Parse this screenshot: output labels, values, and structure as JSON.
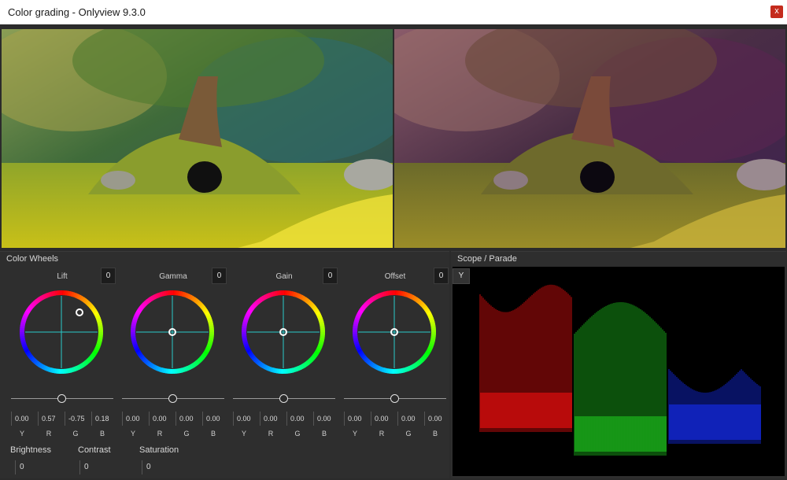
{
  "window": {
    "title": "Color grading - Onlyview  9.3.0",
    "close_label": "x"
  },
  "panels": {
    "wheels_title": "Color Wheels",
    "scope_title": "Scope / Parade"
  },
  "wheels": [
    {
      "name": "Lift",
      "count": "0",
      "values": [
        "0.00",
        "0.57",
        "-0.75",
        "0.18"
      ],
      "slider": 0.5
    },
    {
      "name": "Gamma",
      "count": "0",
      "values": [
        "0.00",
        "0.00",
        "0.00",
        "0.00"
      ],
      "slider": 0.5
    },
    {
      "name": "Gain",
      "count": "0",
      "values": [
        "0.00",
        "0.00",
        "0.00",
        "0.00"
      ],
      "slider": 0.5
    },
    {
      "name": "Offset",
      "count": "0",
      "values": [
        "0.00",
        "0.00",
        "0.00",
        "0.00"
      ],
      "slider": 0.5
    }
  ],
  "channels": [
    "Y",
    "R",
    "G",
    "B"
  ],
  "adjustments": {
    "brightness_label": "Brightness",
    "brightness_value": "0",
    "contrast_label": "Contrast",
    "contrast_value": "0",
    "saturation_label": "Saturation",
    "saturation_value": "0"
  },
  "scope": {
    "mode_button": "Y"
  },
  "colors": {
    "cross": "#29c9c9",
    "red": "#ff1010",
    "green": "#20d020",
    "blue": "#1830ff"
  },
  "icons": {
    "close": "close-icon",
    "wheel": "color-wheel-icon"
  }
}
